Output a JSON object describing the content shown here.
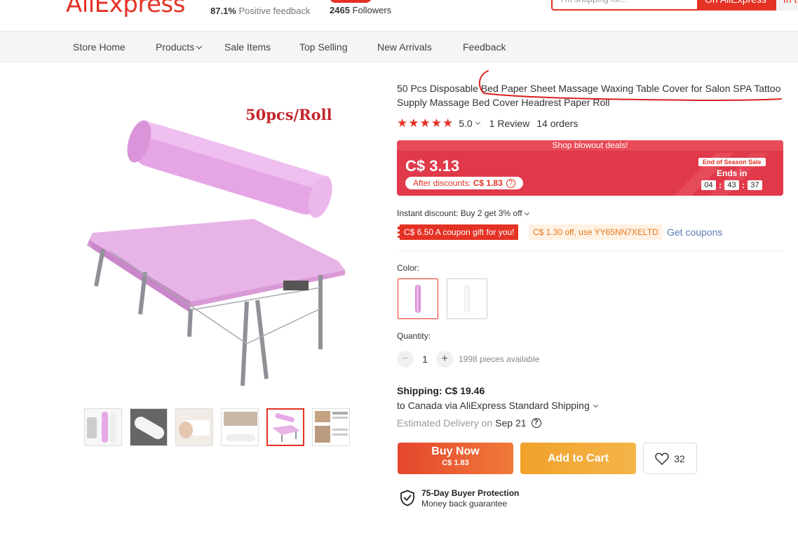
{
  "header": {
    "logo": "AliExpress",
    "positive_feedback_value": "87.1%",
    "positive_feedback_label": "Positive feedback",
    "followers_value": "2465",
    "followers_label": "Followers",
    "search_placeholder": "I'm shopping for...",
    "search_button": "On AliExpress",
    "search_button2": "In t"
  },
  "nav": {
    "items": [
      "Store Home",
      "Products",
      "Sale Items",
      "Top Selling",
      "New Arrivals",
      "Feedback"
    ]
  },
  "product": {
    "image_caption": "50pcs/Roll",
    "title_part1": "50 Pcs Disposable ",
    "title_part2": "Bed Paper Sheet Massage Waxing Table Cover for Salon SPA Tatto",
    "title_part3": "o Supply Massage Bed Cover Headrest Paper Roll",
    "rating": "5.0",
    "stars": "★★★★★",
    "reviews": "1 Review",
    "orders": "14 orders"
  },
  "deal": {
    "banner": "Shop blowout deals!",
    "price": "C$ 3.13",
    "after_discounts_label": "After discounts:",
    "after_discounts_value": "C$ 1.83",
    "sale_tag": "End of Season Sale",
    "ends_in": "Ends in",
    "timer": [
      "04",
      "43",
      "37"
    ]
  },
  "discounts": {
    "instant": "Instant discount: Buy 2 get 3% off",
    "coupon_gift": "C$ 6.50 A coupon gift for you!",
    "coupon_code": "C$ 1.30 off, use YY65NN7XELTD",
    "get_coupons": "Get coupons"
  },
  "options": {
    "color_label": "Color:",
    "quantity_label": "Quantity:",
    "quantity_value": "1",
    "available": "1998 pieces available",
    "minus": "−",
    "plus": "+"
  },
  "shipping": {
    "title": "Shipping: C$ 19.46",
    "method": "to Canada via AliExpress Standard Shipping",
    "est_label": "Estimated Delivery on",
    "est_date": "Sep 21",
    "qmark": "?"
  },
  "actions": {
    "buy_now": "Buy Now",
    "buy_now_price": "C$ 1.83",
    "add_to_cart": "Add to Cart",
    "wishlist_count": "32"
  },
  "protection": {
    "title": "75-Day Buyer Protection",
    "subtitle": "Money back guarantee"
  },
  "colors": {
    "brand": "#e43225",
    "deal_bg": "#e0394a",
    "buy_now": "#e5462d",
    "add_to_cart": "#f0a12a",
    "annotation": "#d6221e"
  }
}
